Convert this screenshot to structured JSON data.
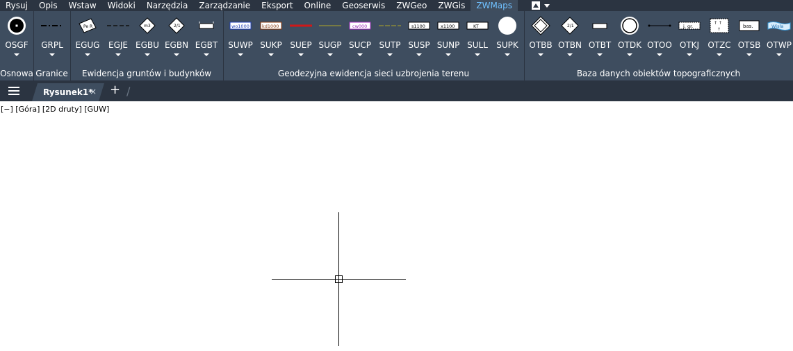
{
  "menu": {
    "items": [
      "Rysuj",
      "Opis",
      "Wstaw",
      "Widoki",
      "Narzędzia",
      "Zarządzanie",
      "Eksport",
      "Online",
      "Geoserwis",
      "ZWGeo",
      "ZWGis",
      "ZWMaps"
    ],
    "active": "ZWMaps"
  },
  "ribbon": {
    "panels": [
      {
        "label": "Osnowa",
        "tools": [
          {
            "label": "OSGF"
          }
        ]
      },
      {
        "label": "Granice",
        "tools": [
          {
            "label": "GRPL"
          }
        ]
      },
      {
        "label": "Ewidencja gruntów i budynków",
        "tools": [
          {
            "label": "EGUG",
            "icon_text": "Pe R"
          },
          {
            "label": "EGJE"
          },
          {
            "label": "EGBU",
            "icon_text": "m3"
          },
          {
            "label": "EGBN",
            "icon_text": "2/1"
          },
          {
            "label": "EGBT"
          }
        ]
      },
      {
        "label": "Geodezyjna ewidencja sieci uzbrojenia terenu",
        "tools": [
          {
            "label": "SUWP",
            "icon_text": "wo1000"
          },
          {
            "label": "SUKP",
            "icon_text": "kd1000"
          },
          {
            "label": "SUEP"
          },
          {
            "label": "SUGP"
          },
          {
            "label": "SUCP",
            "icon_text": "cw000"
          },
          {
            "label": "SUTP"
          },
          {
            "label": "SUSP",
            "icon_text": "s1100"
          },
          {
            "label": "SUNP",
            "icon_text": "x1100"
          },
          {
            "label": "SULL",
            "icon_text": "KT"
          },
          {
            "label": "SUPK"
          }
        ]
      },
      {
        "label": "Baza danych obiektów topograficznych",
        "tools": [
          {
            "label": "OTBB"
          },
          {
            "label": "OTBN",
            "icon_text": "2/1"
          },
          {
            "label": "OTBT"
          },
          {
            "label": "OTDK"
          },
          {
            "label": "OTOO"
          },
          {
            "label": "OTKJ",
            "icon_text": "j. gr."
          },
          {
            "label": "OTZC"
          },
          {
            "label": "OTSB",
            "icon_text": "bas."
          },
          {
            "label": "OTWP",
            "icon_text": "Wisła"
          }
        ]
      }
    ]
  },
  "tabs": {
    "document": "Rysunek1*",
    "close": "×",
    "new": "+"
  },
  "viewport": {
    "label": "[−] [Góra] [2D druty] [GUW]"
  },
  "colors": {
    "menubar_bg": "#2b3441",
    "ribbon_bg": "#3e4d5f",
    "active_menu": "#6fc0ff",
    "canvas_bg": "#ffffff"
  }
}
